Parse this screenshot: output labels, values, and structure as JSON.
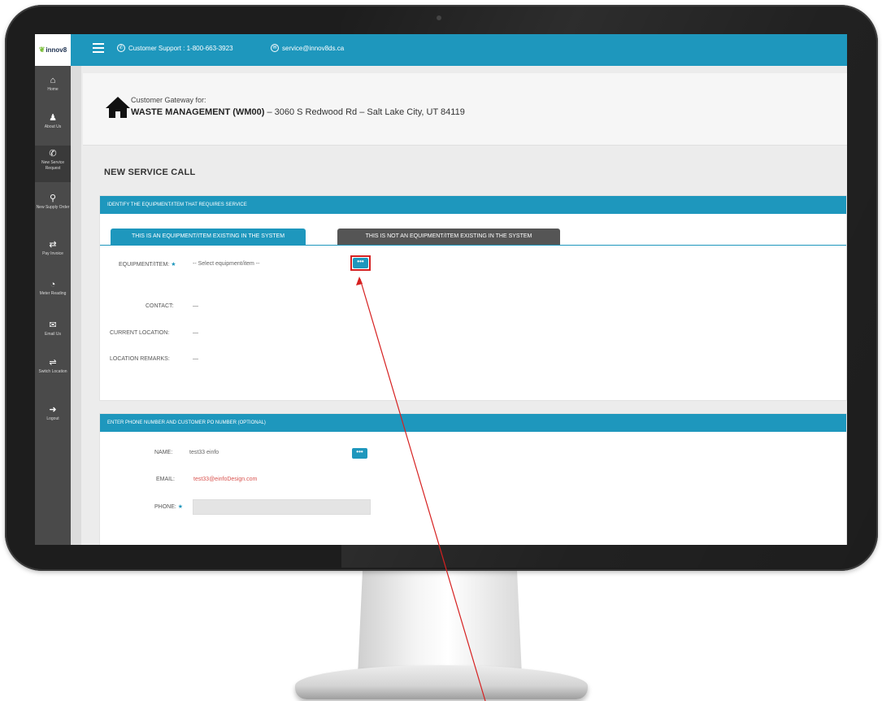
{
  "topbar": {
    "logo_text": "innov8",
    "support_text": "Customer Support : 1-800-663-3923",
    "service_email": "service@innov8ds.ca"
  },
  "sidebar": {
    "items": [
      {
        "icon": "home-icon",
        "label": "Home"
      },
      {
        "icon": "user-icon",
        "label": "About Us"
      },
      {
        "icon": "phone-icon",
        "label": "New Service Request"
      },
      {
        "icon": "supply-order-icon",
        "label": "New Supply Order"
      },
      {
        "icon": "handshake-icon",
        "label": "Pay Invoice"
      },
      {
        "icon": "gauge-icon",
        "label": "Meter Reading"
      },
      {
        "icon": "envelope-icon",
        "label": "Email Us"
      },
      {
        "icon": "switch-location-icon",
        "label": "Switch Location"
      },
      {
        "icon": "logout-icon",
        "label": "Logout"
      }
    ]
  },
  "gateway": {
    "label": "Customer Gateway for:",
    "customer_name": "WASTE MANAGEMENT (WM00)",
    "address": " – 3060 S Redwood Rd – Salt Lake City, UT 84119"
  },
  "page": {
    "title": "NEW SERVICE CALL"
  },
  "equipment_section": {
    "header": "IDENTIFY THE EQUIPMENT/ITEM THAT REQUIRES SERVICE",
    "tab_existing": "THIS IS AN EQUIPMENT/ITEM EXISTING IN THE SYSTEM",
    "tab_not_existing": "THIS IS NOT AN EQUIPMENT/ITEM EXISTING IN THE SYSTEM",
    "equipment_label": "EQUIPMENT/ITEM:",
    "required_mark": "★",
    "equipment_value": "-- Select equipment/item --",
    "picker_label": "•••",
    "contact_label": "CONTACT:",
    "contact_value": "—",
    "location_label": "CURRENT LOCATION:",
    "location_value": "—",
    "remarks_label": "LOCATION REMARKS:",
    "remarks_value": "—"
  },
  "contact_section": {
    "header": "ENTER PHONE NUMBER AND CUSTOMER PO NUMBER (OPTIONAL)",
    "name_label": "NAME:",
    "name_value": "test33 einfo",
    "picker_label": "•••",
    "email_label": "EMAIL:",
    "email_value": "test33@einfoDesign.com",
    "phone_label": "PHONE:",
    "required_mark": "★",
    "phone_value": ""
  },
  "colors": {
    "accent": "#1e97bd",
    "sidebar": "#4a4a4a",
    "highlight": "#d62020",
    "email": "#d9534f"
  }
}
